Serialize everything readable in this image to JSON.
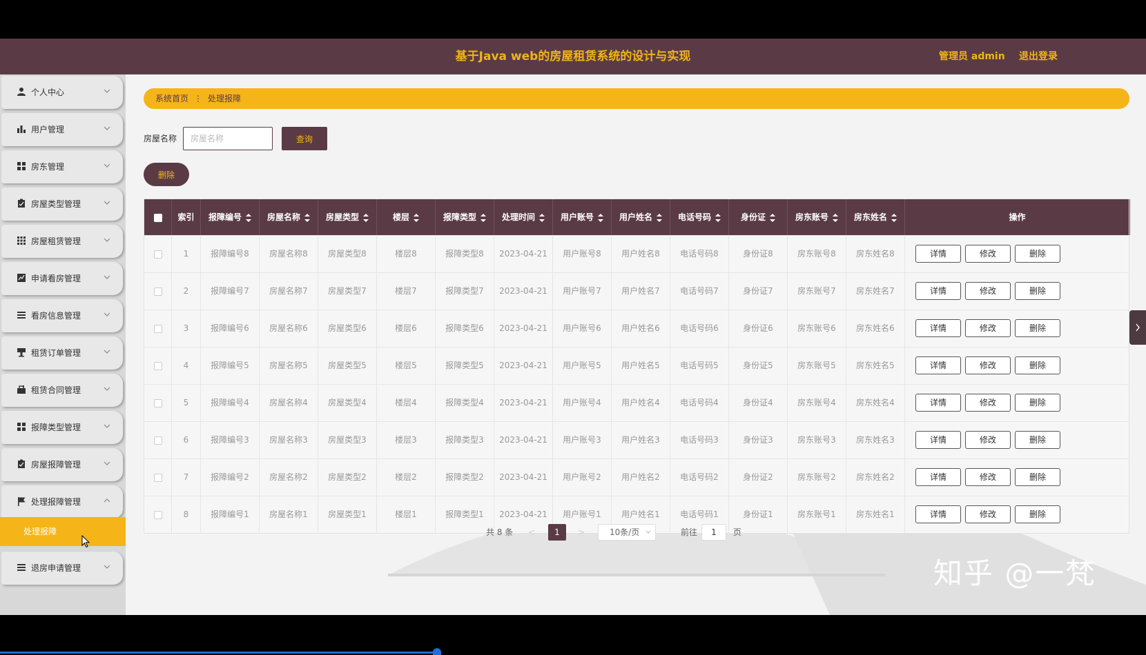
{
  "header": {
    "title": "基于Java web的房屋租赁系统的设计与实现",
    "admin_label": "管理员 admin",
    "logout_label": "退出登录"
  },
  "sidebar": {
    "items": [
      {
        "label": "个人中心",
        "icon": "user-icon"
      },
      {
        "label": "用户管理",
        "icon": "bar-chart-icon"
      },
      {
        "label": "房东管理",
        "icon": "grid-icon"
      },
      {
        "label": "房屋类型管理",
        "icon": "clipboard-icon"
      },
      {
        "label": "房屋租赁管理",
        "icon": "apps-icon"
      },
      {
        "label": "申请看房管理",
        "icon": "chart-box-icon"
      },
      {
        "label": "看房信息管理",
        "icon": "list-icon"
      },
      {
        "label": "租赁订单管理",
        "icon": "podium-icon"
      },
      {
        "label": "租赁合同管理",
        "icon": "case-icon"
      },
      {
        "label": "报障类型管理",
        "icon": "grid-icon"
      },
      {
        "label": "房屋报障管理",
        "icon": "clipboard-icon"
      },
      {
        "label": "处理报障管理",
        "icon": "flag-icon"
      },
      {
        "label": "退房申请管理",
        "icon": "list-icon"
      }
    ],
    "active_sub": "处理报障"
  },
  "breadcrumb": {
    "home": "系统首页",
    "current": "处理报障"
  },
  "search": {
    "label": "房屋名称",
    "placeholder": "房屋名称",
    "query_button": "查询"
  },
  "delete_button": "删除",
  "table": {
    "columns": [
      "索引",
      "报障编号",
      "房屋名称",
      "房屋类型",
      "楼层",
      "报障类型",
      "处理时间",
      "用户账号",
      "用户姓名",
      "电话号码",
      "身份证",
      "房东账号",
      "房东姓名",
      "操作"
    ],
    "rows": [
      [
        "1",
        "报障编号8",
        "房屋名称8",
        "房屋类型8",
        "楼层8",
        "报障类型8",
        "2023-04-21",
        "用户账号8",
        "用户姓名8",
        "电话号码8",
        "身份证8",
        "房东账号8",
        "房东姓名8"
      ],
      [
        "2",
        "报障编号7",
        "房屋名称7",
        "房屋类型7",
        "楼层7",
        "报障类型7",
        "2023-04-21",
        "用户账号7",
        "用户姓名7",
        "电话号码7",
        "身份证7",
        "房东账号7",
        "房东姓名7"
      ],
      [
        "3",
        "报障编号6",
        "房屋名称6",
        "房屋类型6",
        "楼层6",
        "报障类型6",
        "2023-04-21",
        "用户账号6",
        "用户姓名6",
        "电话号码6",
        "身份证6",
        "房东账号6",
        "房东姓名6"
      ],
      [
        "4",
        "报障编号5",
        "房屋名称5",
        "房屋类型5",
        "楼层5",
        "报障类型5",
        "2023-04-21",
        "用户账号5",
        "用户姓名5",
        "电话号码5",
        "身份证5",
        "房东账号5",
        "房东姓名5"
      ],
      [
        "5",
        "报障编号4",
        "房屋名称4",
        "房屋类型4",
        "楼层4",
        "报障类型4",
        "2023-04-21",
        "用户账号4",
        "用户姓名4",
        "电话号码4",
        "身份证4",
        "房东账号4",
        "房东姓名4"
      ],
      [
        "6",
        "报障编号3",
        "房屋名称3",
        "房屋类型3",
        "楼层3",
        "报障类型3",
        "2023-04-21",
        "用户账号3",
        "用户姓名3",
        "电话号码3",
        "身份证3",
        "房东账号3",
        "房东姓名3"
      ],
      [
        "7",
        "报障编号2",
        "房屋名称2",
        "房屋类型2",
        "楼层2",
        "报障类型2",
        "2023-04-21",
        "用户账号2",
        "用户姓名2",
        "电话号码2",
        "身份证2",
        "房东账号2",
        "房东姓名2"
      ],
      [
        "8",
        "报障编号1",
        "房屋名称1",
        "房屋类型1",
        "楼层1",
        "报障类型1",
        "2023-04-21",
        "用户账号1",
        "用户姓名1",
        "电话号码1",
        "身份证1",
        "房东账号1",
        "房东姓名1"
      ]
    ],
    "actions": [
      "详情",
      "修改",
      "删除"
    ]
  },
  "pagination": {
    "total": "共 8 条",
    "prev": "<",
    "current_page": "1",
    "next": ">",
    "page_size": "10条/页",
    "goto_label": "前往",
    "goto_value": "1",
    "page_suffix": "页"
  },
  "watermark": "知乎 @一梵",
  "colors": {
    "header_bg": "#5a3b45",
    "accent": "#f5b418"
  }
}
